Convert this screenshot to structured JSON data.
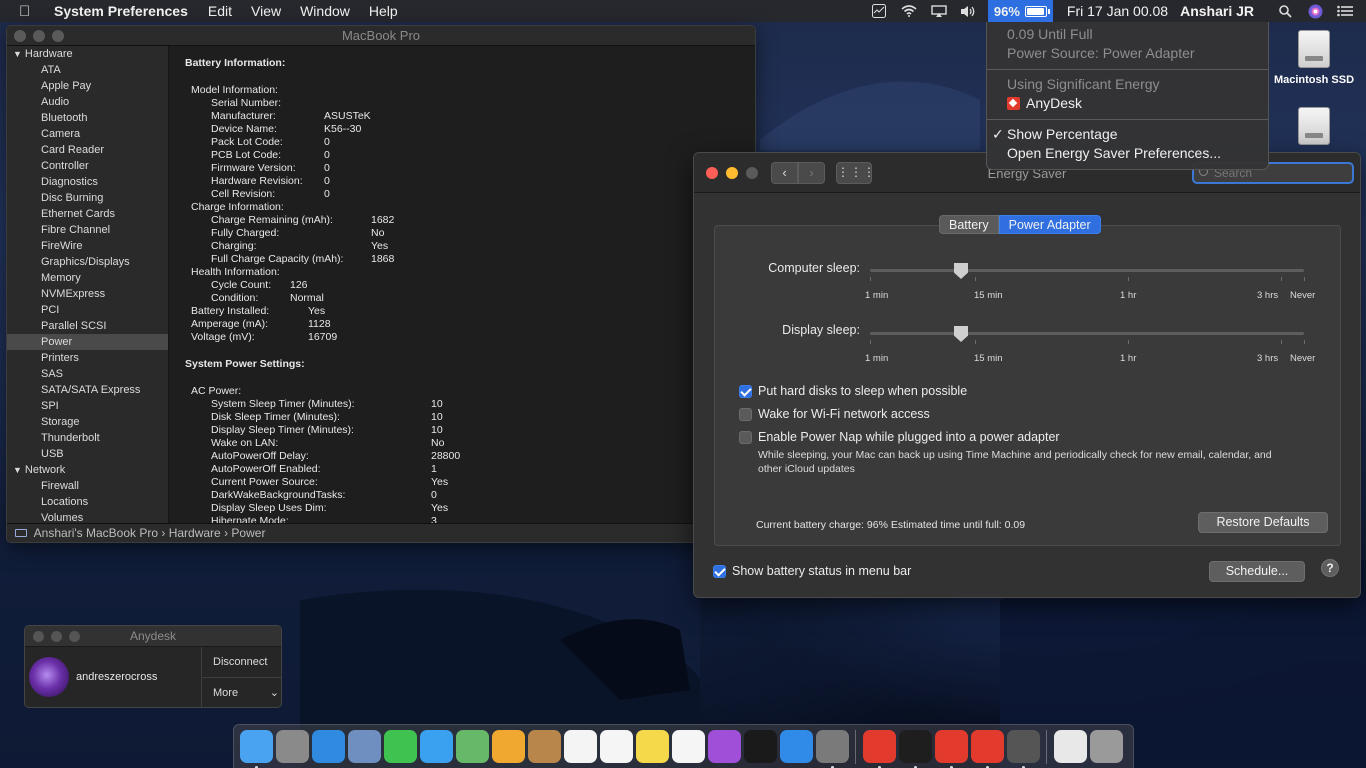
{
  "menubar": {
    "app_name": "System Preferences",
    "menus": [
      "Edit",
      "View",
      "Window",
      "Help"
    ],
    "battery_percent": "96%",
    "clock": "Fri 17 Jan  00.08",
    "user": "Anshari JR"
  },
  "battery_menu": {
    "until_full": "0.09 Until Full",
    "power_source": "Power Source: Power Adapter",
    "significant_energy": "Using Significant Energy",
    "app_using_energy": "AnyDesk",
    "show_percentage": "Show Percentage",
    "open_prefs": "Open Energy Saver Preferences..."
  },
  "sysinfo": {
    "title": "MacBook Pro",
    "sidebar": {
      "hardware_label": "Hardware",
      "hardware_items": [
        "ATA",
        "Apple Pay",
        "Audio",
        "Bluetooth",
        "Camera",
        "Card Reader",
        "Controller",
        "Diagnostics",
        "Disc Burning",
        "Ethernet Cards",
        "Fibre Channel",
        "FireWire",
        "Graphics/Displays",
        "Memory",
        "NVMExpress",
        "PCI",
        "Parallel SCSI",
        "Power",
        "Printers",
        "SAS",
        "SATA/SATA Express",
        "SPI",
        "Storage",
        "Thunderbolt",
        "USB"
      ],
      "selected": "Power",
      "network_label": "Network",
      "network_items": [
        "Firewall",
        "Locations",
        "Volumes"
      ]
    },
    "content": {
      "battery_info_title": "Battery Information:",
      "model_info": "Model Information:",
      "rows": [
        {
          "k": "Serial Number:",
          "v": "",
          "indent": 2,
          "vx": 155
        },
        {
          "k": "Manufacturer:",
          "v": "ASUSTeK",
          "indent": 2,
          "vx": 155
        },
        {
          "k": "Device Name:",
          "v": "K56--30",
          "indent": 2,
          "vx": 155
        },
        {
          "k": "Pack Lot Code:",
          "v": "0",
          "indent": 2,
          "vx": 155
        },
        {
          "k": "PCB Lot Code:",
          "v": "0",
          "indent": 2,
          "vx": 155
        },
        {
          "k": "Firmware Version:",
          "v": "0",
          "indent": 2,
          "vx": 155
        },
        {
          "k": "Hardware Revision:",
          "v": "0",
          "indent": 2,
          "vx": 155
        },
        {
          "k": "Cell Revision:",
          "v": "0",
          "indent": 2,
          "vx": 155
        },
        {
          "k": "Charge Information:",
          "v": "",
          "indent": 1,
          "vx": 155
        },
        {
          "k": "Charge Remaining (mAh):",
          "v": "1682",
          "indent": 2,
          "vx": 202
        },
        {
          "k": "Fully Charged:",
          "v": "No",
          "indent": 2,
          "vx": 202
        },
        {
          "k": "Charging:",
          "v": "Yes",
          "indent": 2,
          "vx": 202
        },
        {
          "k": "Full Charge Capacity (mAh):",
          "v": "1868",
          "indent": 2,
          "vx": 202
        },
        {
          "k": "Health Information:",
          "v": "",
          "indent": 1,
          "vx": 155
        },
        {
          "k": "Cycle Count:",
          "v": "126",
          "indent": 2,
          "vx": 121
        },
        {
          "k": "Condition:",
          "v": "Normal",
          "indent": 2,
          "vx": 121
        },
        {
          "k": "Battery Installed:",
          "v": "Yes",
          "indent": 1,
          "vx": 139
        },
        {
          "k": "Amperage (mA):",
          "v": "1128",
          "indent": 1,
          "vx": 139
        },
        {
          "k": "Voltage (mV):",
          "v": "16709",
          "indent": 1,
          "vx": 139
        }
      ],
      "system_power_title": "System Power Settings:",
      "ac_power": "AC Power:",
      "ac_rows": [
        {
          "k": "System Sleep Timer (Minutes):",
          "v": "10"
        },
        {
          "k": "Disk Sleep Timer (Minutes):",
          "v": "10"
        },
        {
          "k": "Display Sleep Timer (Minutes):",
          "v": "10"
        },
        {
          "k": "Wake on LAN:",
          "v": "No"
        },
        {
          "k": "AutoPowerOff Delay:",
          "v": "28800"
        },
        {
          "k": "AutoPowerOff Enabled:",
          "v": "1"
        },
        {
          "k": "Current Power Source:",
          "v": "Yes"
        },
        {
          "k": "DarkWakeBackgroundTasks:",
          "v": "0"
        },
        {
          "k": "Display Sleep Uses Dim:",
          "v": "Yes"
        },
        {
          "k": "Hibernate Mode:",
          "v": "3"
        }
      ]
    },
    "pathbar": [
      "Anshari's MacBook Pro",
      "Hardware",
      "Power"
    ]
  },
  "energy_saver": {
    "title": "Energy Saver",
    "search_placeholder": "Search",
    "tabs": [
      "Battery",
      "Power Adapter"
    ],
    "active_tab": "Power Adapter",
    "computer_sleep_label": "Computer sleep:",
    "display_sleep_label": "Display sleep:",
    "slider_ticks": [
      "1 min",
      "15 min",
      "1 hr",
      "3 hrs",
      "Never"
    ],
    "computer_sleep_value": "10 min",
    "display_sleep_value": "10 min",
    "options": [
      {
        "label": "Put hard disks to sleep when possible",
        "checked": true
      },
      {
        "label": "Wake for Wi-Fi network access",
        "checked": false
      },
      {
        "label": "Enable Power Nap while plugged into a power adapter",
        "checked": false
      }
    ],
    "power_nap_note": "While sleeping, your Mac can back up using Time Machine and periodically check for new email, calendar, and other iCloud updates",
    "status": "Current battery charge: 96%  Estimated time until full: 0.09",
    "restore_defaults": "Restore Defaults",
    "show_battery_status": "Show battery status in menu bar",
    "schedule": "Schedule...",
    "help": "?"
  },
  "desktop": {
    "disk_label": "Macintosh SSD"
  },
  "anydesk": {
    "title": "Anydesk",
    "user": "andreszerocross",
    "disconnect": "Disconnect",
    "more": "More"
  },
  "dock": {
    "apps": [
      {
        "name": "finder",
        "color": "#4aa3f0",
        "running": true
      },
      {
        "name": "launchpad",
        "color": "#8a8a8a",
        "running": false
      },
      {
        "name": "safari",
        "color": "#2f8ae0",
        "running": false
      },
      {
        "name": "preview",
        "color": "#6f8fc0",
        "running": false
      },
      {
        "name": "facetime",
        "color": "#3fc24f",
        "running": false
      },
      {
        "name": "messages",
        "color": "#3aa0f0",
        "running": false
      },
      {
        "name": "maps",
        "color": "#68b86a",
        "running": false
      },
      {
        "name": "photos",
        "color": "#f0a830",
        "running": false
      },
      {
        "name": "contacts",
        "color": "#b8864a",
        "running": false
      },
      {
        "name": "calendar",
        "color": "#f4f4f4",
        "running": false
      },
      {
        "name": "reminders",
        "color": "#f5f5f5",
        "running": false
      },
      {
        "name": "notes",
        "color": "#f5d94a",
        "running": false
      },
      {
        "name": "music",
        "color": "#f5f5f5",
        "running": false
      },
      {
        "name": "podcasts",
        "color": "#a04fd8",
        "running": false
      },
      {
        "name": "apple-tv",
        "color": "#1a1a1a",
        "running": false
      },
      {
        "name": "app-store",
        "color": "#2f8ae8",
        "running": false
      },
      {
        "name": "system-preferences",
        "color": "#7a7a7a",
        "running": true
      }
    ],
    "apps2": [
      {
        "name": "anydesk",
        "color": "#e23b2e",
        "running": true
      },
      {
        "name": "terminal",
        "color": "#1e1e1e",
        "running": true
      },
      {
        "name": "anydesk-2",
        "color": "#e23b2e",
        "running": true
      },
      {
        "name": "anydesk-3",
        "color": "#e23b2e",
        "running": true
      },
      {
        "name": "system-information",
        "color": "#555",
        "running": true
      }
    ],
    "apps3": [
      {
        "name": "document",
        "color": "#e8e8e8",
        "running": false
      },
      {
        "name": "trash",
        "color": "#9a9a9a",
        "running": false
      }
    ]
  }
}
